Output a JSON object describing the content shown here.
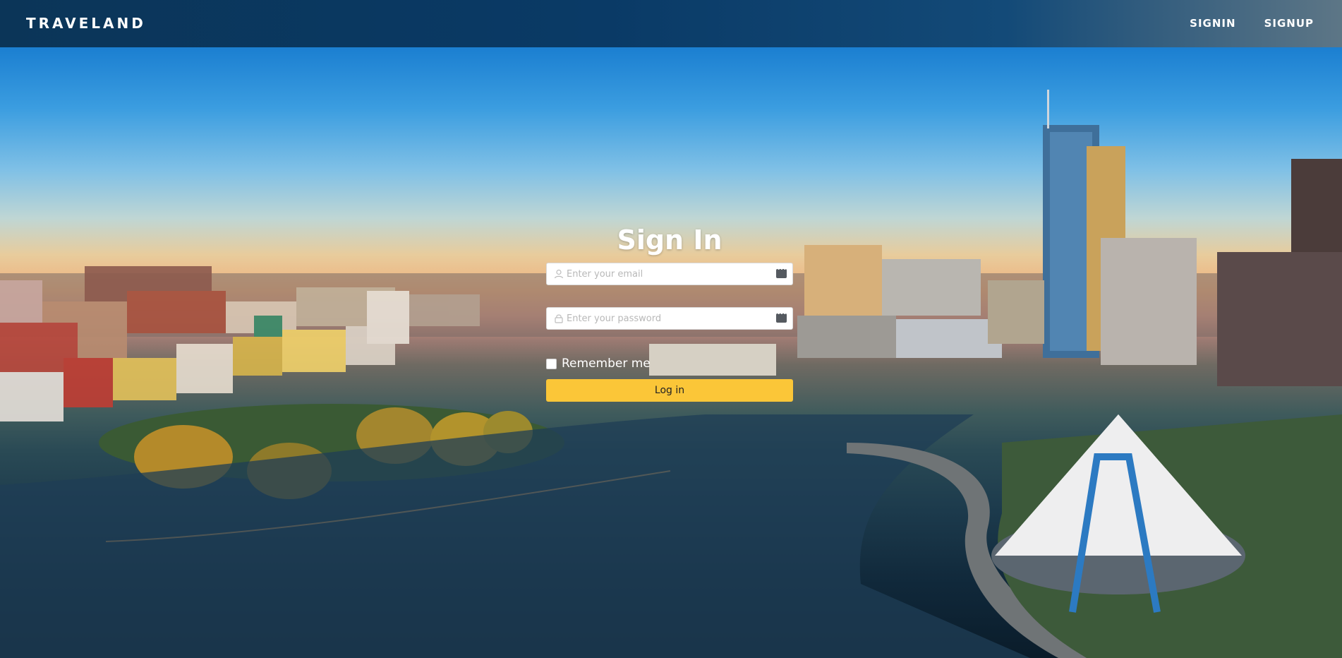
{
  "header": {
    "brand": "TRAVELAND",
    "nav": {
      "signin": "SIGNIN",
      "signup": "SIGNUP"
    }
  },
  "signin_form": {
    "title": "Sign In",
    "email": {
      "placeholder": "Enter your email",
      "icon": "user-icon",
      "value": ""
    },
    "password": {
      "placeholder": "Enter your password",
      "icon": "lock-icon",
      "value": ""
    },
    "remember_label": "Remember me",
    "remember_checked": false,
    "submit_label": "Log in"
  },
  "colors": {
    "header_bg": "#0b3558",
    "button_bg": "#fbc638",
    "text_on_dark": "#ffffff"
  }
}
